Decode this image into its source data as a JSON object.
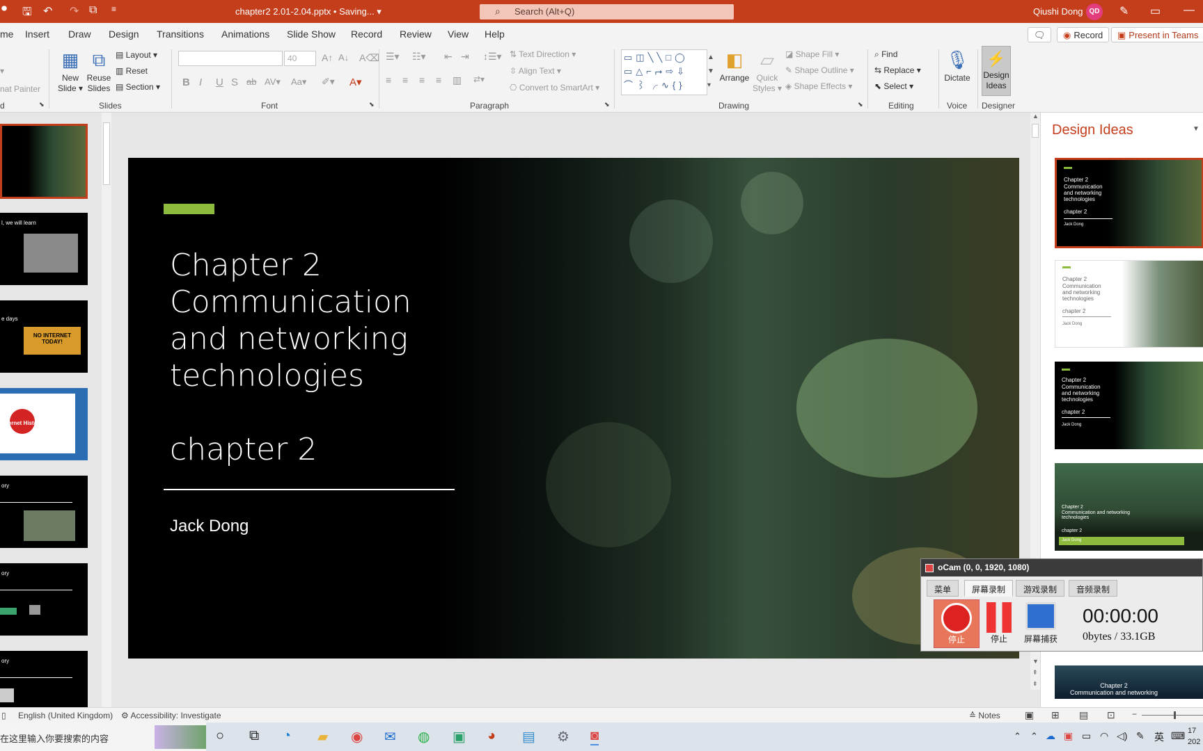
{
  "window": {
    "doc_title": "chapter2 2.01-2.04.pptx • Saving... ▾",
    "search_placeholder": "Search (Alt+Q)",
    "user_name": "Qiushi Dong",
    "user_initials": "QD"
  },
  "tabs": [
    "me",
    "Insert",
    "Draw",
    "Design",
    "Transitions",
    "Animations",
    "Slide Show",
    "Record",
    "Review",
    "View",
    "Help"
  ],
  "tab_actions": {
    "comments": "",
    "record": "Record",
    "present": "Present in Teams"
  },
  "ribbon": {
    "clipboard": {
      "painter": "nat Painter",
      "group": "d"
    },
    "slides": {
      "new_slide": "New Slide ▾",
      "reuse": "Reuse Slides",
      "layout": "Layout ▾",
      "reset": "Reset",
      "section": "Section ▾",
      "group": "Slides"
    },
    "font": {
      "size": "40",
      "group": "Font"
    },
    "paragraph": {
      "text_direction": "Text Direction ▾",
      "align_text": "Align Text ▾",
      "smartart": "Convert to SmartArt ▾",
      "group": "Paragraph"
    },
    "drawing": {
      "arrange": "Arrange",
      "quick_styles": "Quick Styles ▾",
      "shape_fill": "Shape Fill ▾",
      "shape_outline": "Shape Outline ▾",
      "shape_effects": "Shape Effects ▾",
      "group": "Drawing"
    },
    "editing": {
      "find": "Find",
      "replace": "Replace ▾",
      "select": "Select ▾",
      "group": "Editing"
    },
    "voice": {
      "dictate": "Dictate",
      "group": "Voice"
    },
    "designer": {
      "design_ideas": "Design Ideas",
      "group": "Designer"
    }
  },
  "thumbnails": [
    {
      "text": ""
    },
    {
      "text": "l, we will learn"
    },
    {
      "text": "e days",
      "badge": "NO INTERNET TODAY!"
    },
    {
      "text": "Internet History"
    },
    {
      "text": "ory"
    },
    {
      "text": "ory"
    },
    {
      "text": "ory"
    }
  ],
  "slide": {
    "title": "Chapter 2\nCommunication and networking technologies\n\nchapter 2",
    "author": "Jack Dong"
  },
  "design_pane": {
    "title": "Design Ideas",
    "ideas": [
      {
        "t1": "Chapter 2",
        "t2": "Communication and networking technologies",
        "t3": "chapter 2",
        "t4": "Jack Dong"
      },
      {
        "t1": "Chapter 2",
        "t2": "Communication and networking technologies",
        "t3": "chapter 2",
        "t4": "Jack Dong"
      },
      {
        "t1": "Chapter 2",
        "t2": "Communication and networking technologies",
        "t3": "chapter 2",
        "t4": "Jack Dong"
      },
      {
        "t1": "Chapter 2",
        "t2": "Communication and networking technologies",
        "t3": "chapter 2",
        "t4": "Jack Dong"
      },
      {
        "t1": "Chapter 2",
        "t2": "Communication and networking",
        "t3": "",
        "t4": ""
      }
    ]
  },
  "ocam": {
    "title": "oCam (0, 0, 1920, 1080)",
    "tabs": [
      "菜单",
      "屏幕录制",
      "游戏录制",
      "音频录制"
    ],
    "stop_label": "停止",
    "pause_label": "停止",
    "capture_label": "屏幕捕获",
    "timer": "00:00:00",
    "size": "0bytes / 33.1GB"
  },
  "statusbar": {
    "language": "English (United Kingdom)",
    "accessibility": "Accessibility: Investigate",
    "notes": "Notes"
  },
  "taskbar": {
    "search_text": "在这里输入你要搜索的内容",
    "ime": "英",
    "clock": "17\n202"
  },
  "colors": {
    "accent": "#c43e1c",
    "slide_bar": "#8dbb3d"
  }
}
